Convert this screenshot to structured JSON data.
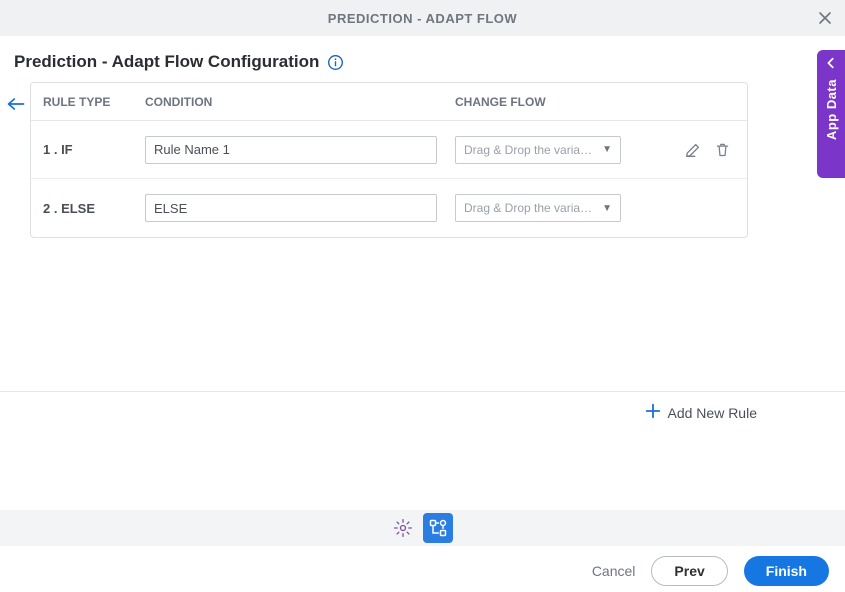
{
  "header": {
    "title": "PREDICTION - ADAPT FLOW"
  },
  "subtitle": "Prediction - Adapt Flow Configuration",
  "sideTab": {
    "label": "App Data"
  },
  "table": {
    "columns": {
      "ruleType": "RULE TYPE",
      "condition": "CONDITION",
      "changeFlow": "CHANGE FLOW"
    },
    "rows": [
      {
        "index": "1",
        "type": "IF",
        "condition": "Rule Name 1",
        "flowPlaceholder": "Drag & Drop the varia…",
        "editable": true
      },
      {
        "index": "2",
        "type": "ELSE",
        "condition": "ELSE",
        "flowPlaceholder": "Drag & Drop the varia…",
        "editable": false
      }
    ],
    "row1": {
      "label": "1 . IF",
      "condition": "Rule Name 1",
      "flowPlaceholder": "Drag & Drop the varia…"
    },
    "row2": {
      "label": "2 . ELSE",
      "condition": "ELSE",
      "flowPlaceholder": "Drag & Drop the varia…"
    }
  },
  "actions": {
    "addRule": "Add New Rule",
    "cancel": "Cancel",
    "prev": "Prev",
    "finish": "Finish"
  }
}
